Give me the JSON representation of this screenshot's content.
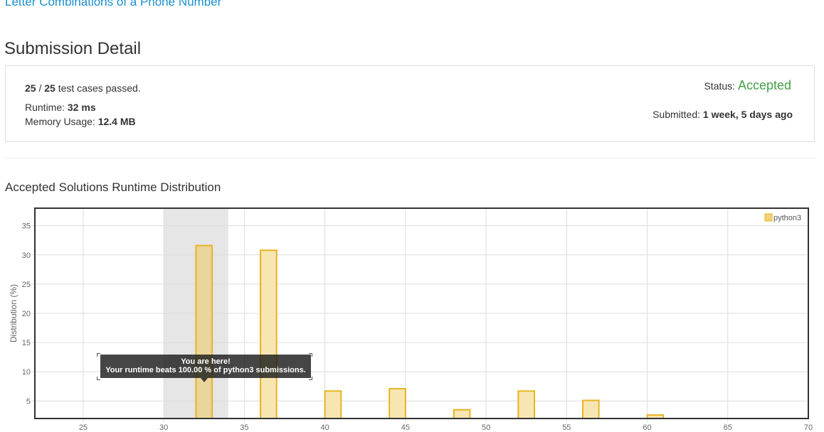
{
  "problem": {
    "title": "Letter Combinations of a Phone Number"
  },
  "page": {
    "title": "Submission Detail"
  },
  "submission": {
    "passed": "25",
    "sep": " / ",
    "total": "25",
    "passed_suffix": " test cases passed.",
    "runtime_label": "Runtime: ",
    "runtime": "32 ms",
    "memory_label": "Memory Usage: ",
    "memory": "12.4 MB",
    "status_label": "Status: ",
    "status": "Accepted",
    "submitted_label": "Submitted: ",
    "submitted": "1 week, 5 days ago"
  },
  "distribution": {
    "title": "Accepted Solutions Runtime Distribution"
  },
  "tooltip": {
    "line1": "You are here!",
    "line2": "Your runtime beats 100.00 % of python3 submissions."
  },
  "chart_data": {
    "type": "bar",
    "title": "",
    "xlabel": "",
    "ylabel": "Distribution (%)",
    "xlim": [
      22,
      70
    ],
    "ylim": [
      2,
      38
    ],
    "xticks": [
      25,
      30,
      35,
      40,
      45,
      50,
      55,
      60,
      65,
      70
    ],
    "yticks": [
      5,
      10,
      15,
      20,
      25,
      30,
      35
    ],
    "grid": true,
    "legend": "top-right",
    "highlight_range": [
      30,
      34
    ],
    "series": [
      {
        "name": "python3",
        "color": "#e6b422",
        "x": [
          32.5,
          36.5,
          40.5,
          44.5,
          48.5,
          52.5,
          56.5,
          60.5
        ],
        "values": [
          31.6,
          30.8,
          6.7,
          7.1,
          3.5,
          6.7,
          5.1,
          2.6
        ]
      }
    ]
  }
}
